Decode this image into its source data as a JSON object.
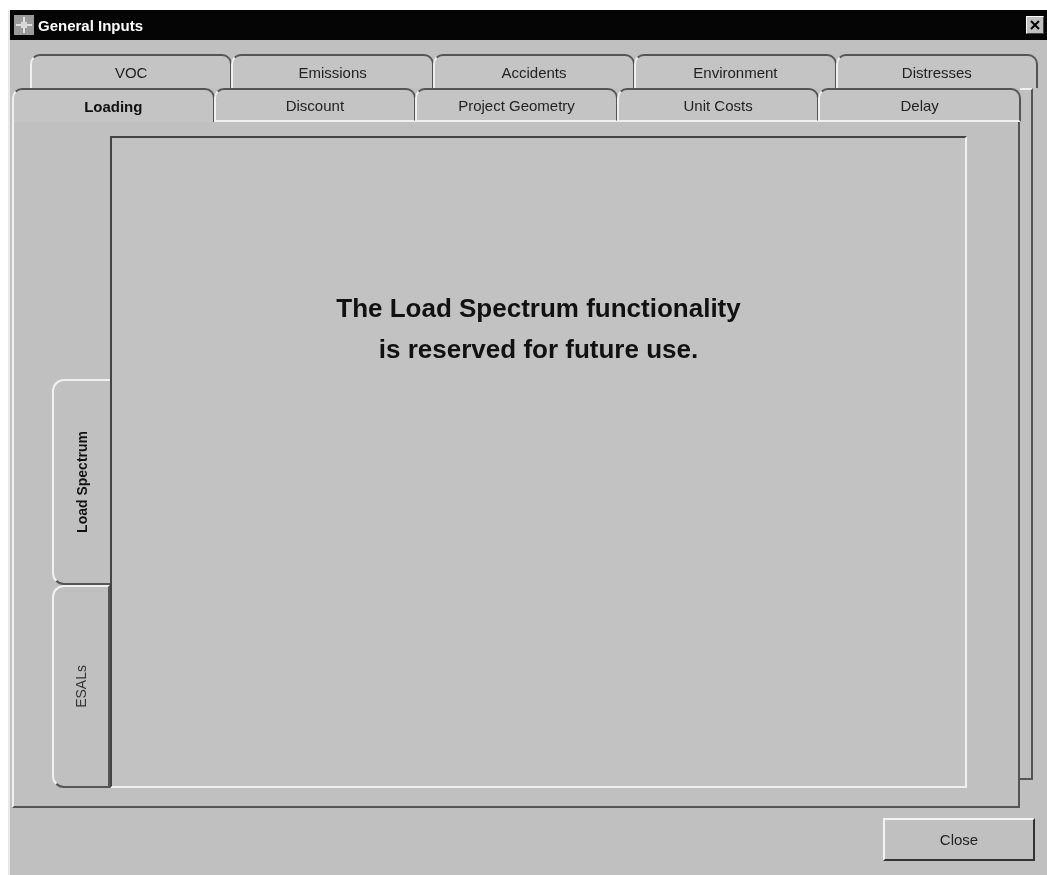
{
  "window": {
    "title": "General Inputs"
  },
  "tab_rows": [
    [
      {
        "label": "VOC",
        "selected": false
      },
      {
        "label": "Emissions",
        "selected": false
      },
      {
        "label": "Accidents",
        "selected": false
      },
      {
        "label": "Environment",
        "selected": false
      },
      {
        "label": "Distresses",
        "selected": false
      }
    ],
    [
      {
        "label": "Loading",
        "selected": true
      },
      {
        "label": "Discount",
        "selected": false
      },
      {
        "label": "Project Geometry",
        "selected": false
      },
      {
        "label": "Unit Costs",
        "selected": false
      },
      {
        "label": "Delay",
        "selected": false
      }
    ]
  ],
  "side_tabs": [
    {
      "label": "Load Spectrum",
      "selected": true
    },
    {
      "label": "ESALs",
      "selected": false
    }
  ],
  "message": "The Load Spectrum functionality is reserved for future use.",
  "buttons": [
    "Close"
  ]
}
